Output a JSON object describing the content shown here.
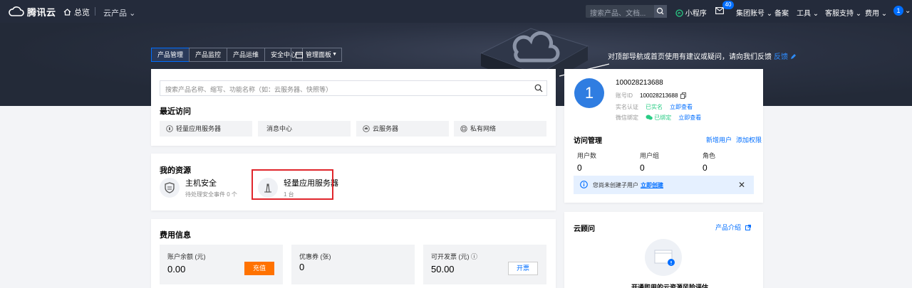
{
  "topnav": {
    "brand": "腾讯云",
    "home": "总览",
    "products": "云产品",
    "search_placeholder": "搜索产品、文档...",
    "mini_program": "小程序",
    "msg_badge": "40",
    "group_account": "集团账号",
    "beian": "备案",
    "tools": "工具",
    "support": "客服支持",
    "fees": "费用",
    "avatar": "1"
  },
  "hero": {
    "feedback_text": "对顶部导航或首页使用有建议或疑问，请向我们反馈",
    "feedback_link": "反馈"
  },
  "tabs": [
    "产品管理",
    "产品监控",
    "产品运维",
    "安全中心"
  ],
  "tab_dropdown": "管理面板",
  "search": {
    "placeholder": "搜索产品名称、缩写、功能名称（如：云服务器、快照等）"
  },
  "recent": {
    "title": "最近访问",
    "items": [
      "轻量应用服务器",
      "消息中心",
      "云服务器",
      "私有网络"
    ]
  },
  "resources": {
    "title": "我的资源",
    "items": [
      {
        "name": "主机安全",
        "sub": "待处理安全事件 0 个"
      },
      {
        "name": "轻量应用服务器",
        "sub": "1 台"
      }
    ]
  },
  "fees": {
    "title": "费用信息",
    "balance_label": "账户余额 (元)",
    "balance": "0.00",
    "charge_btn": "充值",
    "coupon_label": "优惠券 (张)",
    "coupon": "0",
    "invoice_label": "可开发票 (元) ⓘ",
    "invoice": "50.00",
    "invoice_btn": "开票"
  },
  "account": {
    "avatar": "1",
    "id": "100028213688",
    "id_label": "账号ID",
    "id_value": "100028213688",
    "realname_label": "实名认证",
    "realname_status": "已实名",
    "realname_link": "立即查看",
    "wechat_label": "微信绑定",
    "wechat_status": "已绑定",
    "wechat_link": "立即查看"
  },
  "access": {
    "title": "访问管理",
    "add_user": "新增用户",
    "add_perm": "添加权限",
    "stats": [
      {
        "label": "用户数",
        "value": "0"
      },
      {
        "label": "用户组",
        "value": "0"
      },
      {
        "label": "角色",
        "value": "0"
      }
    ],
    "info_text": "您尚未创建子用户",
    "info_link": "立即创建"
  },
  "advisor": {
    "title": "云顾问",
    "link": "产品介绍",
    "caption": "开通即用的云资源风险评估"
  },
  "colors": {
    "topnav_bg": "#242b3b",
    "accent": "#006eff",
    "charge": "#ff7200",
    "highlight": "#e0262c",
    "success": "#29cc85"
  }
}
